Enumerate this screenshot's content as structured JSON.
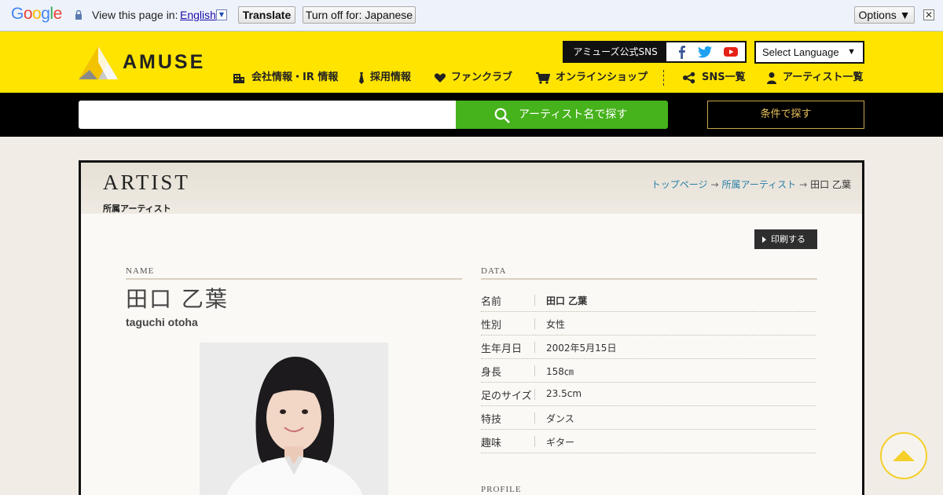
{
  "translate_bar": {
    "logo": "Google",
    "view_label": "View this page in:",
    "language": "English",
    "translate_button": "Translate",
    "turn_off_button": "Turn off for: Japanese",
    "options_button": "Options ▼",
    "close_icon": "close-icon"
  },
  "header": {
    "logo_text": "AMUSE",
    "sns_label": "アミューズ公式SNS",
    "sns_icons": [
      "facebook-icon",
      "twitter-icon",
      "youtube-icon"
    ],
    "language_select": "Select Language",
    "language_arrow": "▼",
    "nav": [
      {
        "label": "会社情報・IR 情報",
        "icon": "building-icon"
      },
      {
        "label": "採用情報",
        "icon": "tie-icon"
      },
      {
        "label": "ファンクラブ",
        "icon": "heart-icon"
      },
      {
        "label": "オンラインショップ",
        "icon": "cart-icon"
      },
      {
        "label": "SNS一覧",
        "icon": "share-icon"
      },
      {
        "label": "アーティスト一覧",
        "icon": "person-icon"
      }
    ],
    "accent_color": "#ffe400"
  },
  "search": {
    "placeholder": "",
    "button_label": "アーティスト名で探す",
    "condition_button": "条件で探す",
    "button_color": "#46b21c"
  },
  "panel": {
    "title": "ARTIST",
    "subtitle": "所属アーティスト",
    "breadcrumb": [
      "トップページ",
      "所属アーティスト",
      "田口 乙葉"
    ],
    "print_button": "印刷する"
  },
  "profile": {
    "name_label": "NAME",
    "name_jp": "田口 乙葉",
    "name_en": "taguchi otoha",
    "data_label": "DATA",
    "profile_label": "PROFILE",
    "data": [
      {
        "key": "名前",
        "value": "田口 乙葉"
      },
      {
        "key": "性別",
        "value": "女性"
      },
      {
        "key": "生年月日",
        "value": "2002年5月15日"
      },
      {
        "key": "身長",
        "value": "158㎝"
      },
      {
        "key": "足のサイズ",
        "value": "23.5cm"
      },
      {
        "key": "特技",
        "value": "ダンス"
      },
      {
        "key": "趣味",
        "value": "ギター"
      }
    ]
  }
}
